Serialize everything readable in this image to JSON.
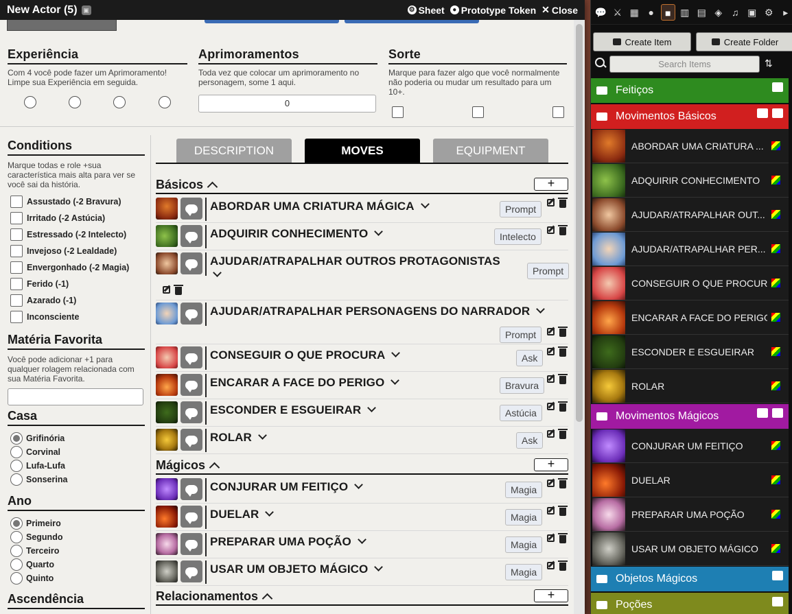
{
  "window": {
    "title": "New Actor (5)",
    "sheet_label": "Sheet",
    "prototype_label": "Prototype Token",
    "close_label": "Close"
  },
  "top": {
    "experiencia": {
      "title": "Experiência",
      "desc": "Com 4 você pode fazer um Aprimoramento! Limpe sua Experiência em seguida."
    },
    "aprimoramentos": {
      "title": "Aprimoramentos",
      "desc": "Toda vez que colocar um aprimoramento no personagem, some 1 aqui.",
      "value": "0"
    },
    "sorte": {
      "title": "Sorte",
      "desc": "Marque para fazer algo que você normalmente não poderia ou mudar um resultado para um 10+."
    }
  },
  "left": {
    "conditions_title": "Conditions",
    "conditions_desc": "Marque todas e role +sua característica mais alta para ver se você sai da história.",
    "conditions": [
      "Assustado (-2 Bravura)",
      "Irritado (-2 Astúcia)",
      "Estressado (-2 Intelecto)",
      "Invejoso (-2 Lealdade)",
      "Envergonhado (-2 Magia)",
      "Ferido (-1)",
      "Azarado (-1)",
      "Inconsciente"
    ],
    "materia_title": "Matéria Favorita",
    "materia_desc": "Você pode adicionar +1 para qualquer rolagem relacionada com sua Matéria Favorita.",
    "casa_title": "Casa",
    "casas": [
      "Grifinória",
      "Corvinal",
      "Lufa-Lufa",
      "Sonserina"
    ],
    "ano_title": "Ano",
    "anos": [
      "Primeiro",
      "Segundo",
      "Terceiro",
      "Quarto",
      "Quinto"
    ],
    "ascendencia_title": "Ascendência"
  },
  "tabs": [
    "DESCRIPTION",
    "MOVES",
    "EQUIPMENT"
  ],
  "groups": {
    "basicos": "Básicos",
    "magicos": "Mágicos",
    "relacionamentos": "Relacionamentos",
    "add": "+"
  },
  "moves": [
    {
      "name": "ABORDAR UMA CRIATURA MÁGICA",
      "roll": "Prompt"
    },
    {
      "name": "ADQUIRIR CONHECIMENTO",
      "roll": "Intelecto"
    },
    {
      "name": "AJUDAR/ATRAPALHAR OUTROS PROTAGONISTAS",
      "roll": "Prompt"
    },
    {
      "name": "AJUDAR/ATRAPALHAR PERSONAGENS DO NARRADOR",
      "roll": "Prompt"
    },
    {
      "name": "CONSEGUIR O QUE PROCURA",
      "roll": "Ask"
    },
    {
      "name": "ENCARAR A FACE DO PERIGO",
      "roll": "Bravura"
    },
    {
      "name": "ESCONDER E ESGUEIRAR",
      "roll": "Astúcia"
    },
    {
      "name": "ROLAR",
      "roll": "Ask"
    },
    {
      "name": "CONJURAR UM FEITIÇO",
      "roll": "Magia"
    },
    {
      "name": "DUELAR",
      "roll": "Magia"
    },
    {
      "name": "PREPARAR UMA POÇÃO",
      "roll": "Magia"
    },
    {
      "name": "USAR UM OBJETO MÁGICO",
      "roll": "Magia"
    }
  ],
  "sidebar": {
    "create_item": "Create Item",
    "create_folder": "Create Folder",
    "search_placeholder": "Search Items",
    "folders": {
      "feiticos": "Feitiços",
      "basicos": "Movimentos Básicos",
      "magicos": "Movimentos Mágicos",
      "objetos": "Objetos Mágicos",
      "pocoes": "Poções"
    },
    "items": [
      "ABORDAR UMA CRIATURA ...",
      "ADQUIRIR CONHECIMENTO",
      "AJUDAR/ATRAPALHAR OUT...",
      "AJUDAR/ATRAPALHAR PER...",
      "CONSEGUIR O QUE PROCURA",
      "ENCARAR A FACE DO PERIGO",
      "ESCONDER E ESGUEIRAR",
      "ROLAR",
      "CONJURAR UM FEITIÇO",
      "DUELAR",
      "PREPARAR UMA POÇÃO",
      "USAR UM OBJETO MÁGICO"
    ]
  },
  "colors": {
    "feiticos": "#2e8b1f",
    "basicos": "#d11f1f",
    "magicos": "#a11aa1",
    "objetos": "#1e7fb3",
    "pocoes": "#7e8a1d"
  }
}
